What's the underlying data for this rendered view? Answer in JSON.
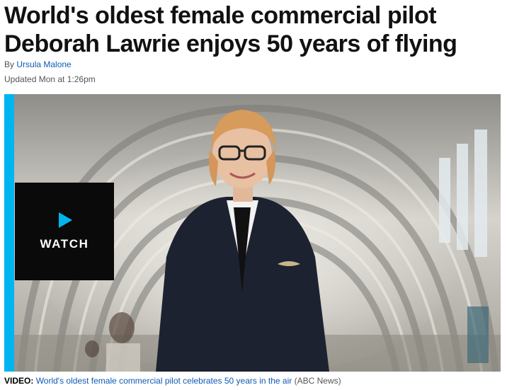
{
  "article": {
    "headline": "World's oldest female commercial pilot Deborah Lawrie enjoys 50 years of flying",
    "byline_prefix": "By",
    "author": "Ursula Malone",
    "updated": "Updated Mon at 1:26pm"
  },
  "media": {
    "watch_label": "WATCH",
    "accent_color": "#00b4ef",
    "caption_prefix": "VIDEO:",
    "caption_link": "World's oldest female commercial pilot celebrates 50 years in the air",
    "caption_source": "(ABC News)"
  },
  "colors": {
    "link": "#0e5ab5",
    "watch_bg": "#0a0a0a"
  }
}
